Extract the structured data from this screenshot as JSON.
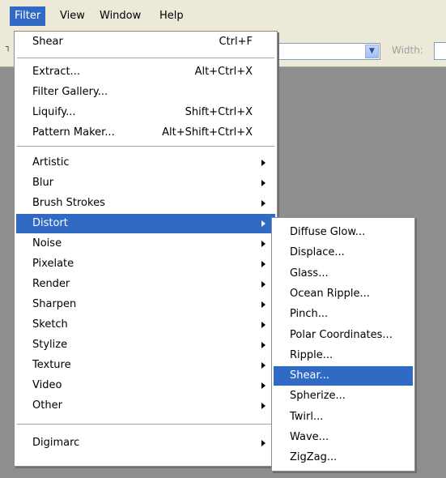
{
  "menubar": {
    "items": [
      "Filter",
      "View",
      "Window",
      "Help"
    ],
    "active_index": 0
  },
  "options_bar": {
    "width_label": "Width:"
  },
  "filter_menu": {
    "items": [
      {
        "label": "Shear",
        "shortcut": "Ctrl+F"
      },
      {
        "label": "Extract...",
        "shortcut": "Alt+Ctrl+X"
      },
      {
        "label": "Filter Gallery...",
        "shortcut": ""
      },
      {
        "label": "Liquify...",
        "shortcut": "Shift+Ctrl+X"
      },
      {
        "label": "Pattern Maker...",
        "shortcut": "Alt+Shift+Ctrl+X"
      },
      {
        "label": "Artistic",
        "submenu": true
      },
      {
        "label": "Blur",
        "submenu": true
      },
      {
        "label": "Brush Strokes",
        "submenu": true
      },
      {
        "label": "Distort",
        "submenu": true,
        "highlighted": true
      },
      {
        "label": "Noise",
        "submenu": true
      },
      {
        "label": "Pixelate",
        "submenu": true
      },
      {
        "label": "Render",
        "submenu": true
      },
      {
        "label": "Sharpen",
        "submenu": true
      },
      {
        "label": "Sketch",
        "submenu": true
      },
      {
        "label": "Stylize",
        "submenu": true
      },
      {
        "label": "Texture",
        "submenu": true
      },
      {
        "label": "Video",
        "submenu": true
      },
      {
        "label": "Other",
        "submenu": true
      },
      {
        "label": "Digimarc",
        "submenu": true
      }
    ]
  },
  "distort_submenu": {
    "items": [
      {
        "label": "Diffuse Glow..."
      },
      {
        "label": "Displace..."
      },
      {
        "label": "Glass..."
      },
      {
        "label": "Ocean Ripple..."
      },
      {
        "label": "Pinch..."
      },
      {
        "label": "Polar Coordinates..."
      },
      {
        "label": "Ripple..."
      },
      {
        "label": "Shear...",
        "highlighted": true
      },
      {
        "label": "Spherize..."
      },
      {
        "label": "Twirl..."
      },
      {
        "label": "Wave..."
      },
      {
        "label": "ZigZag..."
      }
    ]
  },
  "colors": {
    "highlight": "#316ac5",
    "menubar_bg": "#ece9d8"
  }
}
